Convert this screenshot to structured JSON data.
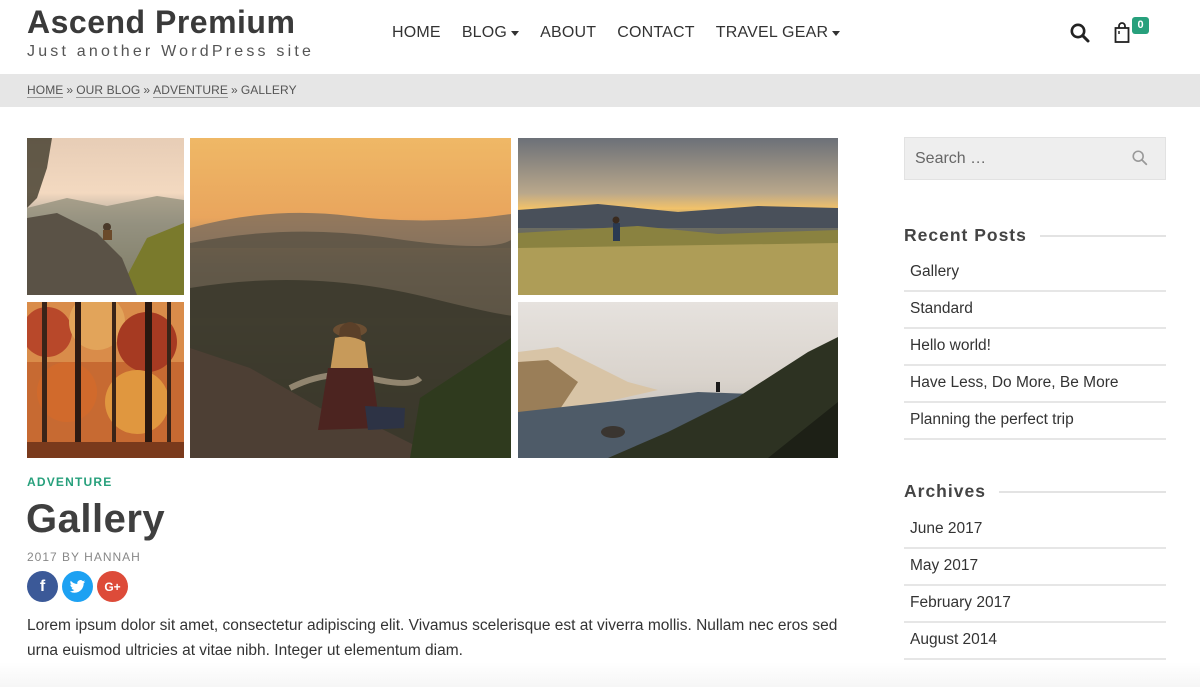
{
  "site": {
    "title": "Ascend Premium",
    "tagline": "Just another WordPress site"
  },
  "nav": [
    {
      "label": "HOME",
      "has_dropdown": false
    },
    {
      "label": "BLOG",
      "has_dropdown": true
    },
    {
      "label": "ABOUT",
      "has_dropdown": false
    },
    {
      "label": "CONTACT",
      "has_dropdown": false
    },
    {
      "label": "TRAVEL GEAR",
      "has_dropdown": true
    }
  ],
  "header_icons": {
    "search": "search-icon",
    "cart": "shopping-bag-icon",
    "cart_count": "0"
  },
  "breadcrumb": {
    "items": [
      "HOME",
      "OUR BLOG",
      "ADVENTURE"
    ],
    "current": "GALLERY",
    "separator": "»"
  },
  "gallery": {
    "images": [
      "hiker-on-cliff-photo",
      "woman-overlooking-valley-photo",
      "hiker-in-meadow-photo",
      "autumn-forest-photo",
      "coastal-cliffs-photo"
    ]
  },
  "post": {
    "category": "ADVENTURE",
    "title": "Gallery",
    "byline": "2017 BY HANNAH",
    "social": {
      "facebook": "f",
      "twitter": "t",
      "google_plus": "G+"
    },
    "excerpt": "Lorem ipsum dolor sit amet, consectetur adipiscing elit. Vivamus scelerisque est at viverra mollis. Nullam nec eros sed urna euismod ultricies at vitae nibh. Integer ut elementum diam."
  },
  "sidebar": {
    "search_placeholder": "Search …",
    "recent_posts": {
      "title": "Recent Posts",
      "items": [
        "Gallery",
        "Standard",
        "Hello world!",
        "Have Less, Do More, Be More",
        "Planning the perfect trip"
      ]
    },
    "archives": {
      "title": "Archives",
      "items": [
        "June 2017",
        "May 2017",
        "February 2017",
        "August 2014"
      ]
    }
  },
  "colors": {
    "accent": "#27a07c",
    "breadcrumb_bg": "#e6e6e6",
    "facebook": "#3b5998",
    "twitter": "#1da1f2",
    "google_plus": "#dd4b39"
  }
}
